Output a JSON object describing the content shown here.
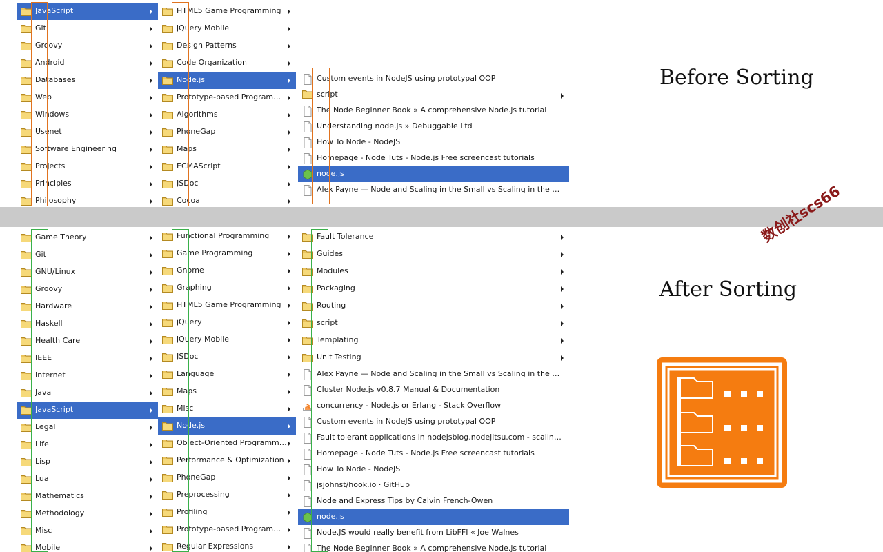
{
  "headings": {
    "before": "Before Sorting",
    "after": "After Sorting"
  },
  "watermark": "数创社scs66",
  "colors": {
    "selection": "#3a6cc7",
    "before_highlight": "#e0731f",
    "after_highlight": "#39b04a",
    "logo": "#f57c10"
  },
  "before": {
    "col1": {
      "items": [
        {
          "label": "JavaScript",
          "icon": "folder-icon",
          "submenu": true,
          "selected": true
        },
        {
          "label": "Git",
          "icon": "folder-icon",
          "submenu": true
        },
        {
          "label": "Groovy",
          "icon": "folder-icon",
          "submenu": true
        },
        {
          "label": "Android",
          "icon": "folder-icon",
          "submenu": true
        },
        {
          "label": "Databases",
          "icon": "folder-icon",
          "submenu": true
        },
        {
          "label": "Web",
          "icon": "folder-icon",
          "submenu": true
        },
        {
          "label": "Windows",
          "icon": "folder-icon",
          "submenu": true
        },
        {
          "label": "Usenet",
          "icon": "folder-icon",
          "submenu": true
        },
        {
          "label": "Software Engineering",
          "icon": "folder-icon",
          "submenu": true
        },
        {
          "label": "Projects",
          "icon": "folder-icon",
          "submenu": true
        },
        {
          "label": "Principles",
          "icon": "folder-icon",
          "submenu": true
        },
        {
          "label": "Philosophy",
          "icon": "folder-icon",
          "submenu": true
        }
      ]
    },
    "col2": {
      "items": [
        {
          "label": "HTML5 Game Programming",
          "icon": "folder-icon",
          "submenu": true
        },
        {
          "label": "jQuery Mobile",
          "icon": "folder-icon",
          "submenu": true
        },
        {
          "label": "Design Patterns",
          "icon": "folder-icon",
          "submenu": true
        },
        {
          "label": "Code Organization",
          "icon": "folder-icon",
          "submenu": true
        },
        {
          "label": "Node.js",
          "icon": "folder-icon",
          "submenu": true,
          "selected": true
        },
        {
          "label": "Prototype-based Programming",
          "icon": "folder-icon",
          "submenu": true
        },
        {
          "label": "Algorithms",
          "icon": "folder-icon",
          "submenu": true
        },
        {
          "label": "PhoneGap",
          "icon": "folder-icon",
          "submenu": true
        },
        {
          "label": "Maps",
          "icon": "folder-icon",
          "submenu": true
        },
        {
          "label": "ECMAScript",
          "icon": "folder-icon",
          "submenu": true
        },
        {
          "label": "JSDoc",
          "icon": "folder-icon",
          "submenu": true
        },
        {
          "label": "Cocoa",
          "icon": "folder-icon",
          "submenu": true
        }
      ]
    },
    "col3": {
      "items": [
        {
          "label": "Custom events in NodeJS using prototypal OOP",
          "icon": "page-icon"
        },
        {
          "label": "script",
          "icon": "folder-icon",
          "submenu": true
        },
        {
          "label": "The Node Beginner Book » A comprehensive Node.js tutorial",
          "icon": "page-icon"
        },
        {
          "label": "Understanding node.js » Debuggable Ltd",
          "icon": "page-icon"
        },
        {
          "label": "How To Node - NodeJS",
          "icon": "page-icon"
        },
        {
          "label": "Homepage - Node Tuts - Node.js Free screencast tutorials",
          "icon": "page-icon"
        },
        {
          "label": "node.js",
          "icon": "nodejs-hex-icon",
          "selected": true
        },
        {
          "label": "Alex Payne — Node and Scaling in the Small vs Scaling in the Large",
          "icon": "page-icon"
        }
      ]
    }
  },
  "after": {
    "col1": {
      "items": [
        {
          "label": "Game Theory",
          "icon": "folder-icon",
          "submenu": true
        },
        {
          "label": "Git",
          "icon": "folder-icon",
          "submenu": true
        },
        {
          "label": "GNU/Linux",
          "icon": "folder-icon",
          "submenu": true
        },
        {
          "label": "Groovy",
          "icon": "folder-icon",
          "submenu": true
        },
        {
          "label": "Hardware",
          "icon": "folder-icon",
          "submenu": true
        },
        {
          "label": "Haskell",
          "icon": "folder-icon",
          "submenu": true
        },
        {
          "label": "Health Care",
          "icon": "folder-icon",
          "submenu": true
        },
        {
          "label": "IEEE",
          "icon": "folder-icon",
          "submenu": true
        },
        {
          "label": "Internet",
          "icon": "folder-icon",
          "submenu": true
        },
        {
          "label": "Java",
          "icon": "folder-icon",
          "submenu": true
        },
        {
          "label": "JavaScript",
          "icon": "folder-icon",
          "submenu": true,
          "selected": true
        },
        {
          "label": "Legal",
          "icon": "folder-icon",
          "submenu": true
        },
        {
          "label": "Life",
          "icon": "folder-icon",
          "submenu": true
        },
        {
          "label": "Lisp",
          "icon": "folder-icon",
          "submenu": true
        },
        {
          "label": "Lua",
          "icon": "folder-icon",
          "submenu": true
        },
        {
          "label": "Mathematics",
          "icon": "folder-icon",
          "submenu": true
        },
        {
          "label": "Methodology",
          "icon": "folder-icon",
          "submenu": true
        },
        {
          "label": "Misc",
          "icon": "folder-icon",
          "submenu": true
        },
        {
          "label": "Mobile",
          "icon": "folder-icon",
          "submenu": true
        }
      ]
    },
    "col2": {
      "items": [
        {
          "label": "Functional Programming",
          "icon": "folder-icon",
          "submenu": true
        },
        {
          "label": "Game Programming",
          "icon": "folder-icon",
          "submenu": true
        },
        {
          "label": "Gnome",
          "icon": "folder-icon",
          "submenu": true
        },
        {
          "label": "Graphing",
          "icon": "folder-icon",
          "submenu": true
        },
        {
          "label": "HTML5 Game Programming",
          "icon": "folder-icon",
          "submenu": true
        },
        {
          "label": "jQuery",
          "icon": "folder-icon",
          "submenu": true
        },
        {
          "label": "jQuery Mobile",
          "icon": "folder-icon",
          "submenu": true
        },
        {
          "label": "JSDoc",
          "icon": "folder-icon",
          "submenu": true
        },
        {
          "label": "Language",
          "icon": "folder-icon",
          "submenu": true
        },
        {
          "label": "Maps",
          "icon": "folder-icon",
          "submenu": true
        },
        {
          "label": "Misc",
          "icon": "folder-icon",
          "submenu": true
        },
        {
          "label": "Node.js",
          "icon": "folder-icon",
          "submenu": true,
          "selected": true
        },
        {
          "label": "Object-Oriented Programming",
          "icon": "folder-icon",
          "submenu": true
        },
        {
          "label": "Performance & Optimization",
          "icon": "folder-icon",
          "submenu": true
        },
        {
          "label": "PhoneGap",
          "icon": "folder-icon",
          "submenu": true
        },
        {
          "label": "Preprocessing",
          "icon": "folder-icon",
          "submenu": true
        },
        {
          "label": "Profiling",
          "icon": "folder-icon",
          "submenu": true
        },
        {
          "label": "Prototype-based Programming",
          "icon": "folder-icon",
          "submenu": true
        },
        {
          "label": "Regular Expressions",
          "icon": "folder-icon",
          "submenu": true
        }
      ]
    },
    "col3": {
      "folders": [
        {
          "label": "Fault Tolerance",
          "icon": "folder-icon",
          "submenu": true
        },
        {
          "label": "Guides",
          "icon": "folder-icon",
          "submenu": true
        },
        {
          "label": "Modules",
          "icon": "folder-icon",
          "submenu": true
        },
        {
          "label": "Packaging",
          "icon": "folder-icon",
          "submenu": true
        },
        {
          "label": "Routing",
          "icon": "folder-icon",
          "submenu": true
        },
        {
          "label": "script",
          "icon": "folder-icon",
          "submenu": true
        },
        {
          "label": "Templating",
          "icon": "folder-icon",
          "submenu": true
        },
        {
          "label": "Unit Testing",
          "icon": "folder-icon",
          "submenu": true
        }
      ],
      "bookmarks": [
        {
          "label": "Alex Payne — Node and Scaling in the Small vs Scaling in the Large",
          "icon": "page-icon"
        },
        {
          "label": "Cluster Node.js v0.8.7 Manual & Documentation",
          "icon": "page-icon"
        },
        {
          "label": "concurrency - Node.js or Erlang - Stack Overflow",
          "icon": "stackoverflow-icon"
        },
        {
          "label": "Custom events in NodeJS using prototypal OOP",
          "icon": "page-icon"
        },
        {
          "label": "Fault tolerant applications in nodejsblog.nodejitsu.com - scaling nod...",
          "icon": "page-icon"
        },
        {
          "label": "Homepage - Node Tuts - Node.js Free screencast tutorials",
          "icon": "page-icon"
        },
        {
          "label": "How To Node - NodeJS",
          "icon": "page-icon"
        },
        {
          "label": "jsjohnst/hook.io · GitHub",
          "icon": "page-icon"
        },
        {
          "label": "Node and Express Tips by Calvin French-Owen",
          "icon": "page-icon"
        },
        {
          "label": "node.js",
          "icon": "nodejs-hex-icon",
          "selected": true
        },
        {
          "label": "Node.JS would really benefit from LibFFI « Joe Walnes",
          "icon": "page-icon"
        },
        {
          "label": "The Node Beginner Book » A comprehensive Node.js tutorial",
          "icon": "page-icon"
        }
      ]
    }
  }
}
